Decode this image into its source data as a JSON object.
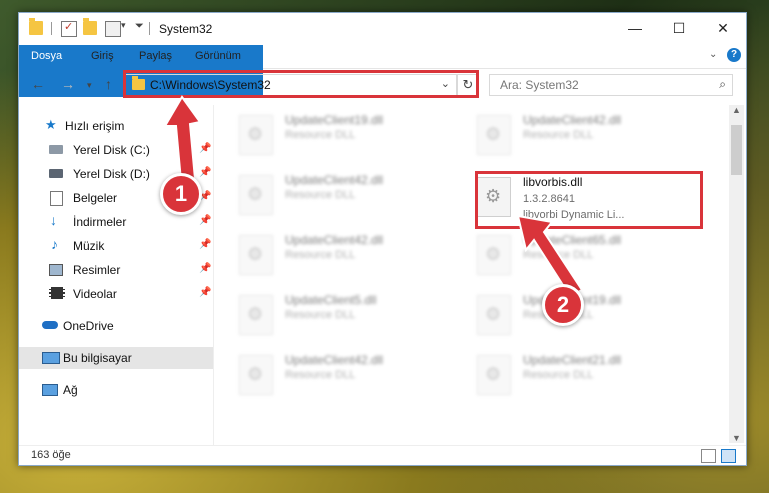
{
  "window": {
    "title": "System32",
    "controls": {
      "minimize": "—",
      "maximize": "☐",
      "close": "✕"
    }
  },
  "ribbon": {
    "tabs": [
      "Dosya",
      "Giriş",
      "Paylaş",
      "Görünüm"
    ],
    "expand": "⌄",
    "help": "?"
  },
  "address_bar": {
    "path": "C:\\Windows\\System32",
    "search_placeholder": "Ara: System32"
  },
  "sidebar": {
    "items": [
      {
        "label": "Hızlı erişim",
        "icon": "star-icon",
        "pinned": false
      },
      {
        "label": "Yerel Disk (C:)",
        "icon": "drive-icon",
        "pinned": true
      },
      {
        "label": "Yerel Disk (D:)",
        "icon": "drive-icon",
        "pinned": true
      },
      {
        "label": "Belgeler",
        "icon": "documents-icon",
        "pinned": true
      },
      {
        "label": "İndirmeler",
        "icon": "download-icon",
        "pinned": true
      },
      {
        "label": "Müzik",
        "icon": "music-icon",
        "pinned": true
      },
      {
        "label": "Resimler",
        "icon": "pictures-icon",
        "pinned": true
      },
      {
        "label": "Videolar",
        "icon": "videos-icon",
        "pinned": true
      },
      {
        "label": "OneDrive",
        "icon": "cloud-icon",
        "pinned": false
      },
      {
        "label": "Bu bilgisayar",
        "icon": "computer-icon",
        "pinned": false,
        "selected": true
      },
      {
        "label": "Ağ",
        "icon": "network-icon",
        "pinned": false
      }
    ]
  },
  "files": {
    "left": [
      {
        "name": "UpdateClient19.dll",
        "type": "Resource DLL"
      },
      {
        "name": "UpdateClient42.dll",
        "type": "Resource DLL"
      },
      {
        "name": "UpdateClient42.dll",
        "type": "Resource DLL"
      },
      {
        "name": "UpdateClient5.dll",
        "type": "Resource DLL"
      },
      {
        "name": "UpdateClient42.dll",
        "type": "Resource DLL"
      }
    ],
    "right": [
      {
        "name": "UpdateClient42.dll",
        "type": "Resource DLL"
      },
      {
        "name": "libvorbis.dll",
        "version": "1.3.2.8641",
        "type": "libvorbi Dynamic Li..."
      },
      {
        "name": "UpdateClient65.dll",
        "type": "Resource DLL"
      },
      {
        "name": "UpdateClient19.dll",
        "type": "Resource DLL"
      },
      {
        "name": "UpdateClient21.dll",
        "type": "Resource DLL"
      }
    ]
  },
  "status": {
    "count": "163 öğe"
  },
  "callouts": [
    "1",
    "2"
  ],
  "colors": {
    "accent": "#1979ca",
    "highlight": "#d9343a"
  }
}
